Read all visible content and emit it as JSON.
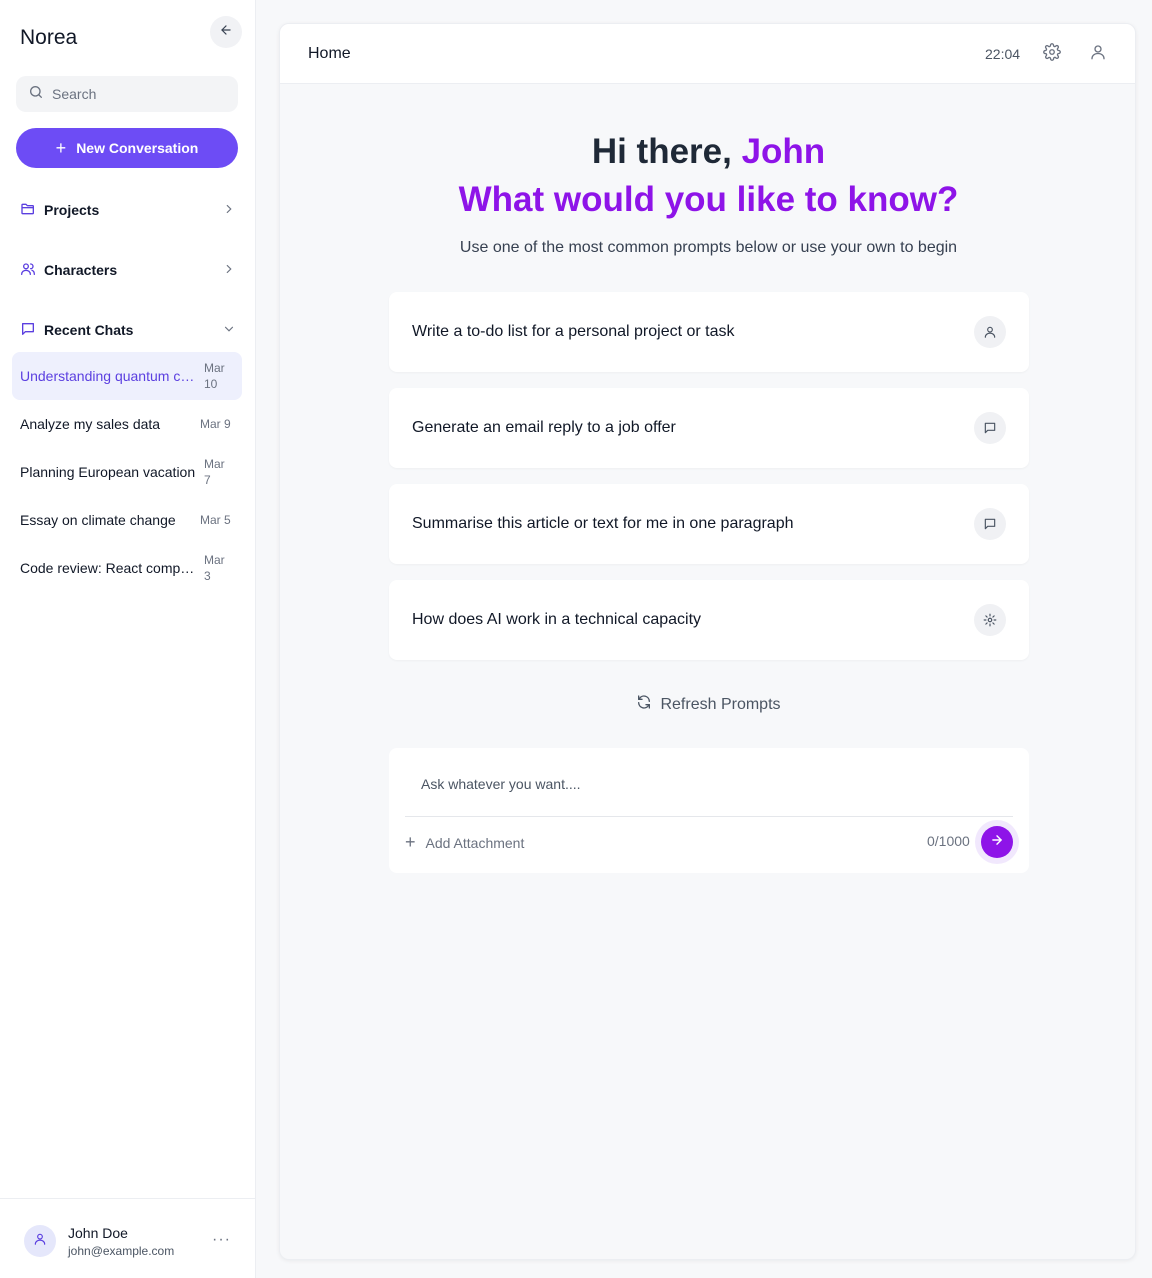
{
  "sidebar": {
    "brand": "Norea",
    "search_placeholder": "Search",
    "new_conversation_label": "New Conversation",
    "sections": {
      "projects": "Projects",
      "characters": "Characters",
      "recent_chats": "Recent Chats"
    },
    "recent_chats": [
      {
        "title": "Understanding quantum computing",
        "date": "Mar 10",
        "active": true
      },
      {
        "title": "Analyze my sales data",
        "date": "Mar 9",
        "active": false
      },
      {
        "title": "Planning European vacation",
        "date": "Mar 7",
        "active": false
      },
      {
        "title": "Essay on climate change",
        "date": "Mar 5",
        "active": false
      },
      {
        "title": "Code review: React component",
        "date": "Mar 3",
        "active": false
      }
    ],
    "user": {
      "name": "John Doe",
      "email": "john@example.com",
      "more_label": "···"
    }
  },
  "header": {
    "title": "Home",
    "time": "22:04"
  },
  "hero": {
    "greeting_prefix": "Hi there, ",
    "greeting_name": "John",
    "headline": "What would you like to know?",
    "subtitle": "Use one of the most common prompts below or use your own to begin"
  },
  "prompts": [
    {
      "text": "Write a to-do list for a personal project or task",
      "icon": "user-icon"
    },
    {
      "text": "Generate an email reply to a job offer",
      "icon": "message-icon"
    },
    {
      "text": "Summarise this article or text for me in one paragraph",
      "icon": "message-icon"
    },
    {
      "text": "How does AI work in a technical capacity",
      "icon": "gear-icon"
    }
  ],
  "refresh_label": "Refresh Prompts",
  "composer": {
    "placeholder": "Ask whatever you want....",
    "attachment_label": "Add Attachment",
    "counter": "0/1000"
  },
  "colors": {
    "accent_purple": "#8e14e8",
    "button_indigo": "#6d4cf5",
    "active_chat_bg": "#eef0fd"
  }
}
